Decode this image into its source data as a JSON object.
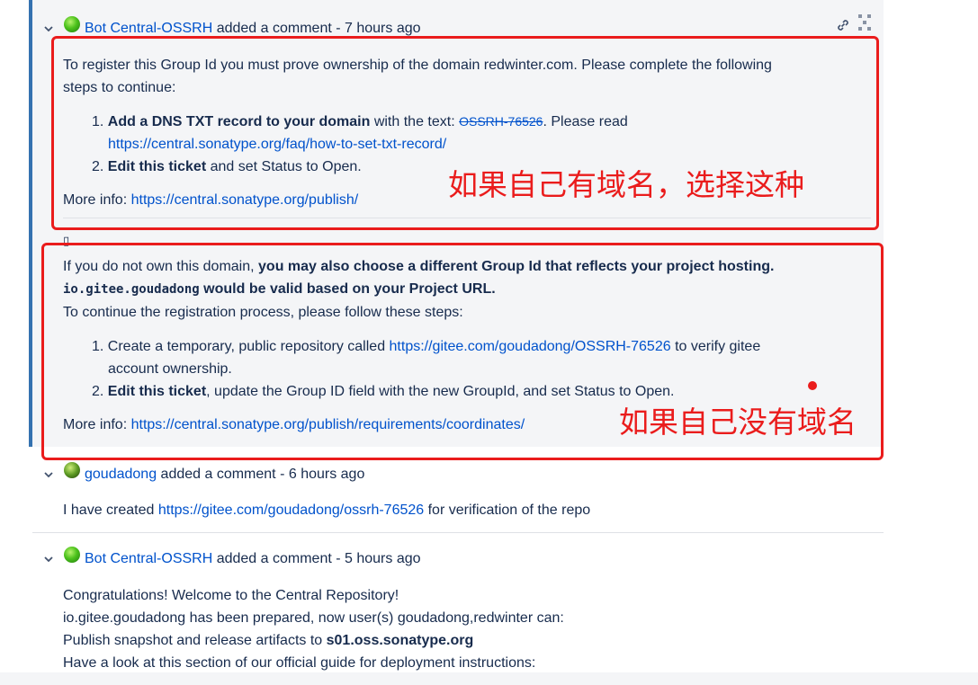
{
  "comment1": {
    "author": "Bot Central-OSSRH",
    "action": " added a comment - ",
    "time": "7 hours ago",
    "block1": {
      "intro": "To register this Group Id you must prove ownership of the domain redwinter.com. Please complete the following",
      "intro2": "steps to continue:",
      "step1_num": "1.",
      "step1_bold": "Add a DNS TXT record to your domain",
      "step1_mid": " with the text: ",
      "step1_code": "OSSRH-76526",
      "step1_end": ". Please read",
      "step1_link": "https://central.sonatype.org/faq/how-to-set-txt-record/",
      "step2_num": "2.",
      "step2_bold": "Edit this ticket",
      "step2_rest": " and set Status to Open.",
      "more_label": "More info: ",
      "more_link": "https://central.sonatype.org/publish/"
    },
    "placeholder_glyph": "▯",
    "block2": {
      "intro_plain": "If you do not own this domain, ",
      "intro_bold": "you may also choose a different Group Id that reflects your project hosting.",
      "groupid_code": "io.gitee.goudadong",
      "groupid_bold": " would be valid based on your Project URL.",
      "continue": "To continue the registration process, please follow these steps:",
      "step1_num": "1.",
      "step1_pre": "Create a temporary, public repository called ",
      "step1_link": "https://gitee.com/goudadong/OSSRH-76526",
      "step1_post": " to verify gitee",
      "step1_line2": "account ownership.",
      "step2_num": "2.",
      "step2_bold": "Edit this ticket",
      "step2_rest": ", update the Group ID field with the new GroupId, and set Status to Open.",
      "more_label": "More info: ",
      "more_link": "https://central.sonatype.org/publish/requirements/coordinates/"
    }
  },
  "annotations": {
    "note1": "如果自己有域名，选择这种",
    "note2": "如果自己没有域名",
    "box_color": "#ea1c1c"
  },
  "comment2": {
    "author": "goudadong",
    "action": " added a comment - ",
    "time": "6 hours ago",
    "body_pre": "I have created ",
    "body_link": "https://gitee.com/goudadong/ossrh-76526",
    "body_post": " for verification of the repo"
  },
  "comment3": {
    "author": "Bot Central-OSSRH",
    "action": " added a comment - ",
    "time": "5 hours ago",
    "line1": "Congratulations! Welcome to the Central Repository!",
    "line2": "io.gitee.goudadong has been prepared, now user(s) goudadong,redwinter can:",
    "line3_pre": "Publish snapshot and release artifacts to ",
    "line3_bold": "s01.oss.sonatype.org",
    "line4": "Have a look at this section of our official guide for deployment instructions:"
  },
  "icons": {
    "permalink": "link-icon",
    "collapse": "chevron-down-icon",
    "resize": "expand-icon"
  },
  "colors": {
    "link": "#0052cc",
    "focused_bg": "#f4f5f7",
    "focus_bar": "#3572b0"
  }
}
